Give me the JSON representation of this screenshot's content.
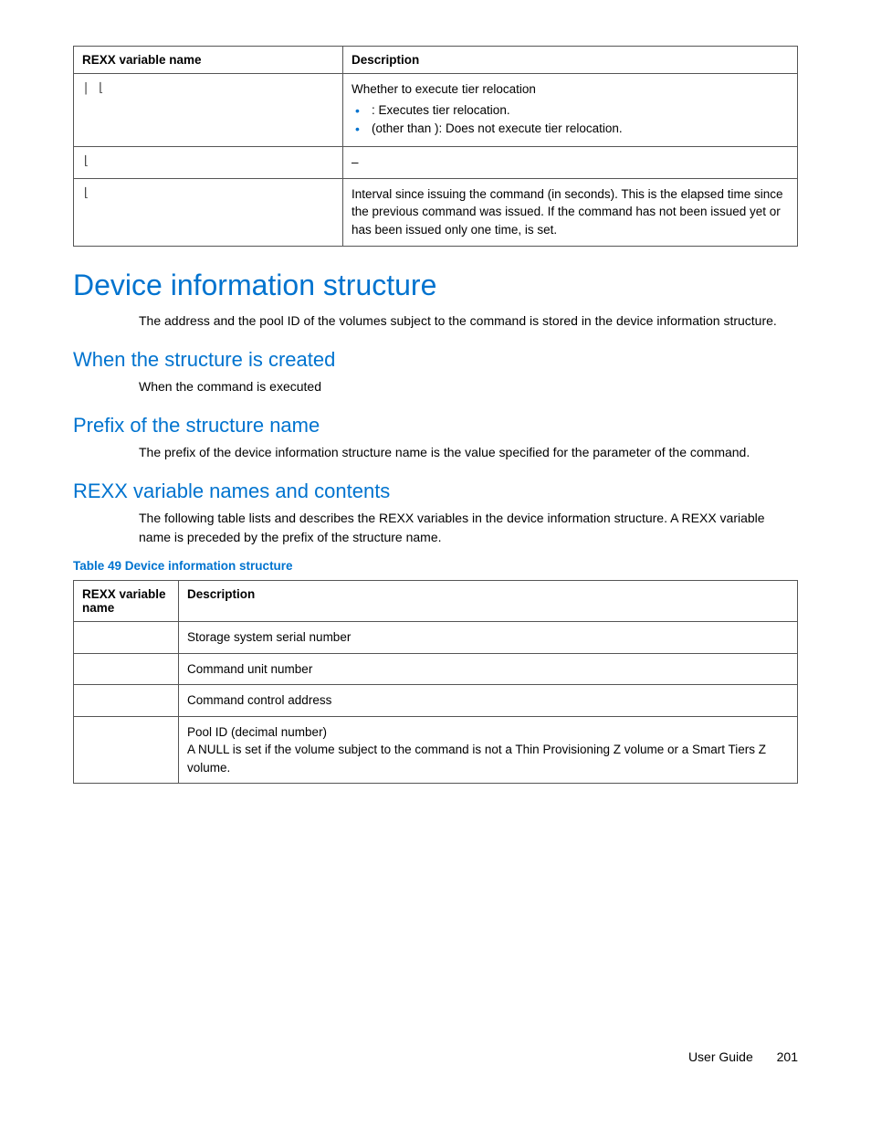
{
  "table1": {
    "headers": [
      "REXX variable name",
      "Description"
    ],
    "rows": [
      {
        "name_glyph": "| ⌊",
        "desc_lead": "Whether to execute tier relocation",
        "bullets": [
          ": Executes tier relocation.",
          "(other than  ): Does not execute tier relocation."
        ]
      },
      {
        "name_glyph": "⌊",
        "desc": "–"
      },
      {
        "name_glyph": "⌊",
        "desc": "Interval since issuing the                    command (in seconds). This is the elapsed time since the previous                     command was issued. If the command has not been issued yet or has been issued only one time,    is set."
      }
    ]
  },
  "h1": "Device information structure",
  "p1": "The address and the pool ID of the volumes subject to the                     command is stored in the device information structure.",
  "h2a": "When the structure is created",
  "p2": "When the                    command is executed",
  "h2b": "Prefix of the structure name",
  "p3": "The prefix of the device information structure name is the value specified for the          parameter of the                    command.",
  "h2c": "REXX variable names and contents",
  "p4": "The following table lists and describes the REXX variables in the device information structure. A REXX variable name is preceded by the prefix of the structure name.",
  "table2_caption": "Table 49 Device information structure",
  "table2": {
    "headers": [
      "REXX variable name",
      "Description"
    ],
    "rows": [
      {
        "name": "",
        "desc": "Storage system serial number"
      },
      {
        "name": "",
        "desc": "Command unit number"
      },
      {
        "name": "",
        "desc": "Command control address"
      },
      {
        "name": "",
        "desc": "Pool ID (decimal number)\nA NULL is set if the volume subject to the                     command is not a Thin Provisioning Z volume or a Smart Tiers Z volume."
      }
    ]
  },
  "footer": {
    "label": "User Guide",
    "page": "201"
  }
}
